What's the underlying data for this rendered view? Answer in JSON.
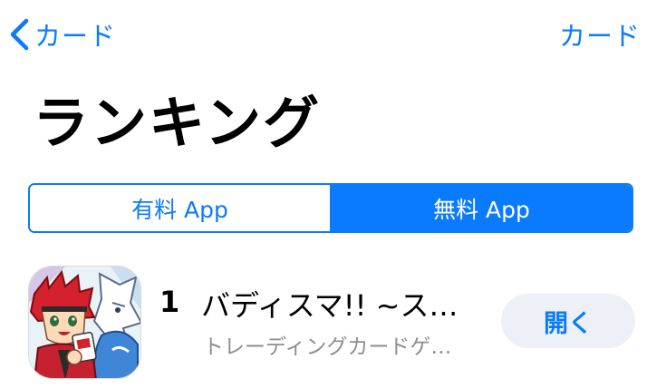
{
  "nav": {
    "back_label": "カード",
    "right_label": "カード"
  },
  "page": {
    "title": "ランキング"
  },
  "segments": {
    "paid": "有料 App",
    "free": "無料 App",
    "selected": "free"
  },
  "ranking": {
    "items": [
      {
        "rank": "1",
        "name": "バディスマ!! ~ス…",
        "category": "トレーディングカードゲ…",
        "button_label": "開く"
      }
    ]
  },
  "colors": {
    "accent": "#0a7aff",
    "button_bg": "#eef0f7",
    "secondary_text": "#8e8e93"
  }
}
